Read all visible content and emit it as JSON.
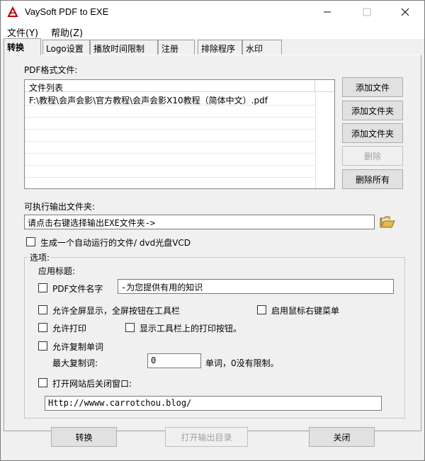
{
  "window": {
    "title": "VaySoft PDF to EXE"
  },
  "menubar": [
    {
      "label": "文件(Y)"
    },
    {
      "label": "帮助(Z)"
    }
  ],
  "tabs": [
    {
      "label": "转换"
    },
    {
      "label": "Logo设置"
    },
    {
      "label": "播放时间限制"
    },
    {
      "label": "注册"
    },
    {
      "label": "排除程序"
    },
    {
      "label": "水印"
    }
  ],
  "pdf_section": {
    "label": "PDF格式文件:",
    "list_header": "文件列表",
    "files": [
      "F:\\教程\\会声会影\\官方教程\\会声会影X10教程（简体中文）.pdf"
    ],
    "buttons": {
      "add_file": "添加文件",
      "add_folder": "添加文件夹",
      "add_folder2": "添加文件夹",
      "delete": "删除",
      "delete_all": "删除所有"
    }
  },
  "output": {
    "label": "可执行输出文件夹:",
    "value": "请点击右键选择输出EXE文件夹->"
  },
  "autorun": {
    "label": "生成一个自动运行的文件/ dvd光盘VCD"
  },
  "options": {
    "group_title": "选项:",
    "app_title_label": "应用标题:",
    "pdf_filename_label": "PDF文件名字",
    "title_value": "-为您提供有用的知识",
    "fullscreen_label": "允许全屏显示，全屏按钮在工具栏",
    "right_menu_label": "启用鼠标右键菜单",
    "print_label": "允许打印",
    "print_button_label": "显示工具栏上的打印按钮。",
    "copy_label": "允许复制单词",
    "max_copy_label": "最大复制词:",
    "max_copy_value": "0",
    "max_copy_hint": "单词，0没有限制。",
    "open_site_label": "打开网站后关闭窗口:",
    "url_value": "Http://wwww.carrotchou.blog/"
  },
  "footer": {
    "convert": "转换",
    "open_output": "打开输出目录",
    "close": "关闭"
  }
}
